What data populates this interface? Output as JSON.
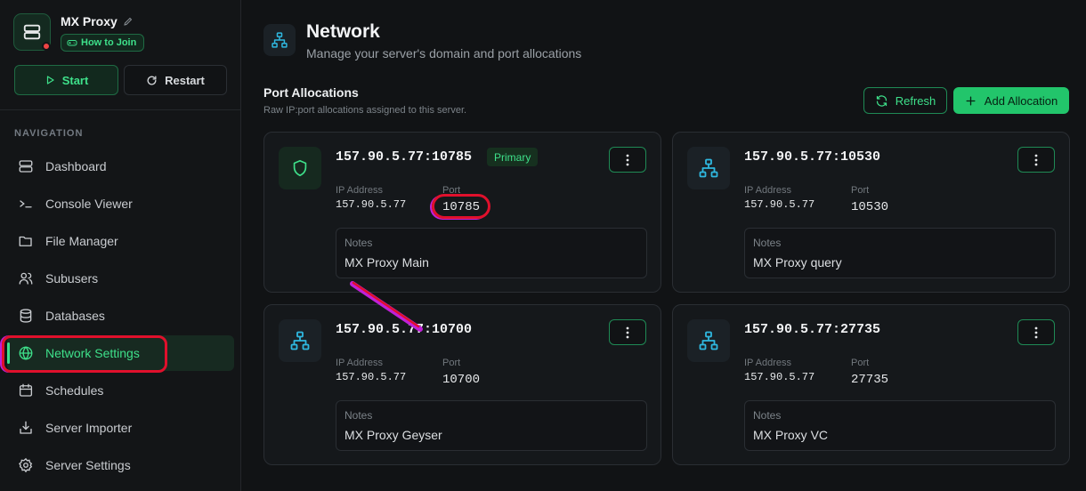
{
  "server": {
    "name": "MX Proxy",
    "how_to_join": "How to Join"
  },
  "actions": {
    "start": "Start",
    "restart": "Restart"
  },
  "nav": {
    "heading": "NAVIGATION",
    "items": [
      {
        "label": "Dashboard",
        "icon": "server-icon"
      },
      {
        "label": "Console Viewer",
        "icon": "terminal-icon"
      },
      {
        "label": "File Manager",
        "icon": "folder-icon"
      },
      {
        "label": "Subusers",
        "icon": "users-icon"
      },
      {
        "label": "Databases",
        "icon": "database-icon"
      },
      {
        "label": "Network Settings",
        "icon": "globe-icon",
        "active": true
      },
      {
        "label": "Schedules",
        "icon": "calendar-icon"
      },
      {
        "label": "Server Importer",
        "icon": "import-icon"
      },
      {
        "label": "Server Settings",
        "icon": "gear-icon"
      }
    ]
  },
  "page": {
    "title": "Network",
    "subtitle": "Manage your server's domain and port allocations"
  },
  "section": {
    "title": "Port Allocations",
    "subtitle": "Raw IP:port allocations assigned to this server.",
    "refresh": "Refresh",
    "add": "Add Allocation"
  },
  "labels": {
    "ip": "IP Address",
    "port": "Port",
    "notes": "Notes",
    "primary": "Primary"
  },
  "allocations": [
    {
      "address": "157.90.5.77:10785",
      "ip": "157.90.5.77",
      "port": "10785",
      "notes": "MX Proxy Main",
      "primary": true
    },
    {
      "address": "157.90.5.77:10530",
      "ip": "157.90.5.77",
      "port": "10530",
      "notes": "MX Proxy query",
      "primary": false
    },
    {
      "address": "157.90.5.77:10700",
      "ip": "157.90.5.77",
      "port": "10700",
      "notes": "MX Proxy Geyser",
      "primary": false
    },
    {
      "address": "157.90.5.77:27735",
      "ip": "157.90.5.77",
      "port": "27735",
      "notes": "MX Proxy VC",
      "primary": false
    }
  ],
  "colors": {
    "accent": "#3ee08a",
    "accent_button": "#22c56b",
    "icon_blue": "#2fb8e0",
    "highlight": "#e0102c"
  }
}
